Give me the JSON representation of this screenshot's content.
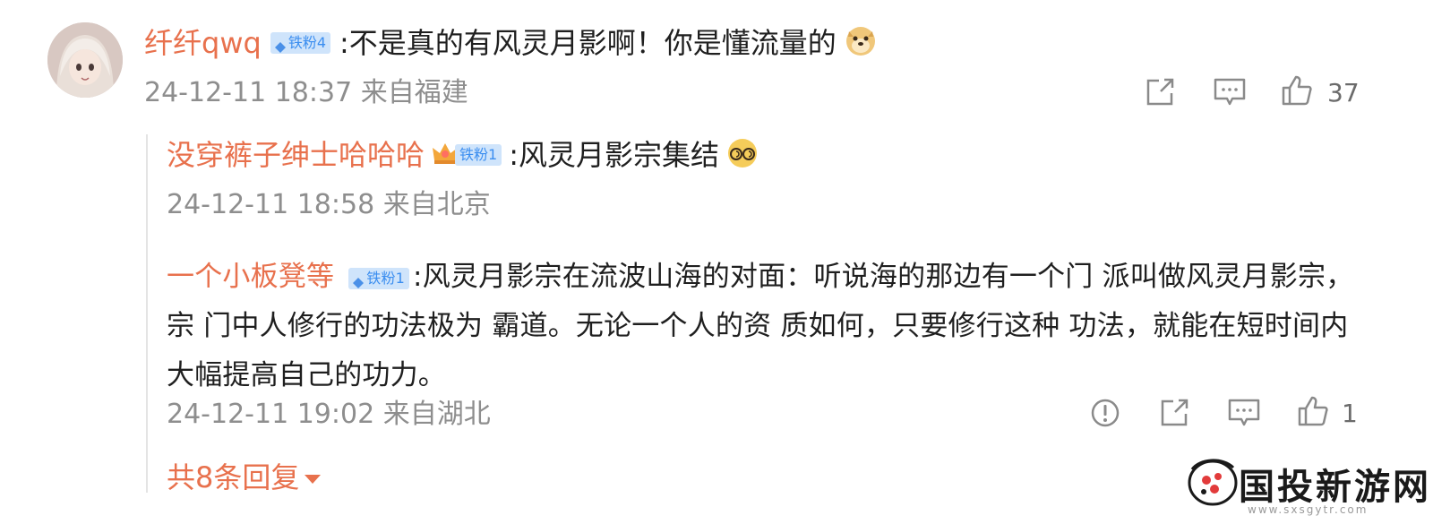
{
  "comment": {
    "username": "纤纤qwq",
    "badge": "铁粉4",
    "text": ":不是真的有风灵月影啊！你是懂流量的",
    "meta": "24-12-11 18:37 来自福建",
    "like_count": "37"
  },
  "replies": [
    {
      "username": "没穿裤子绅士哈哈哈",
      "badge": "铁粉1",
      "text": ":风灵月影宗集结",
      "meta": "24-12-11 18:58 来自北京"
    },
    {
      "username": "一个小板凳等",
      "badge": "铁粉1",
      "text": ":风灵月影宗在流波山海的对面：听说海的那边有一个门 派叫做风灵月影宗，宗 门中人修行的功法极为 霸道。无论一个人的资 质如何，只要修行这种 功法，就能在短时间内 大幅提高自己的功力。",
      "meta": "24-12-11 19:02 来自湖北",
      "like_count": "1"
    }
  ],
  "more_replies": "共8条回复",
  "watermark": {
    "name": "国投新游网",
    "url": "www.sxsgytr.com"
  },
  "colors": {
    "username": "#e8714d",
    "badge_bg": "#cfe4fb",
    "badge_text": "#3b8ef0",
    "meta": "#8e8e8e"
  },
  "icons": [
    "share-icon",
    "comment-icon",
    "like-icon",
    "report-icon",
    "diamond-icon",
    "crown-icon",
    "doge-emoji",
    "dizzy-emoji",
    "arrow-down-icon"
  ]
}
